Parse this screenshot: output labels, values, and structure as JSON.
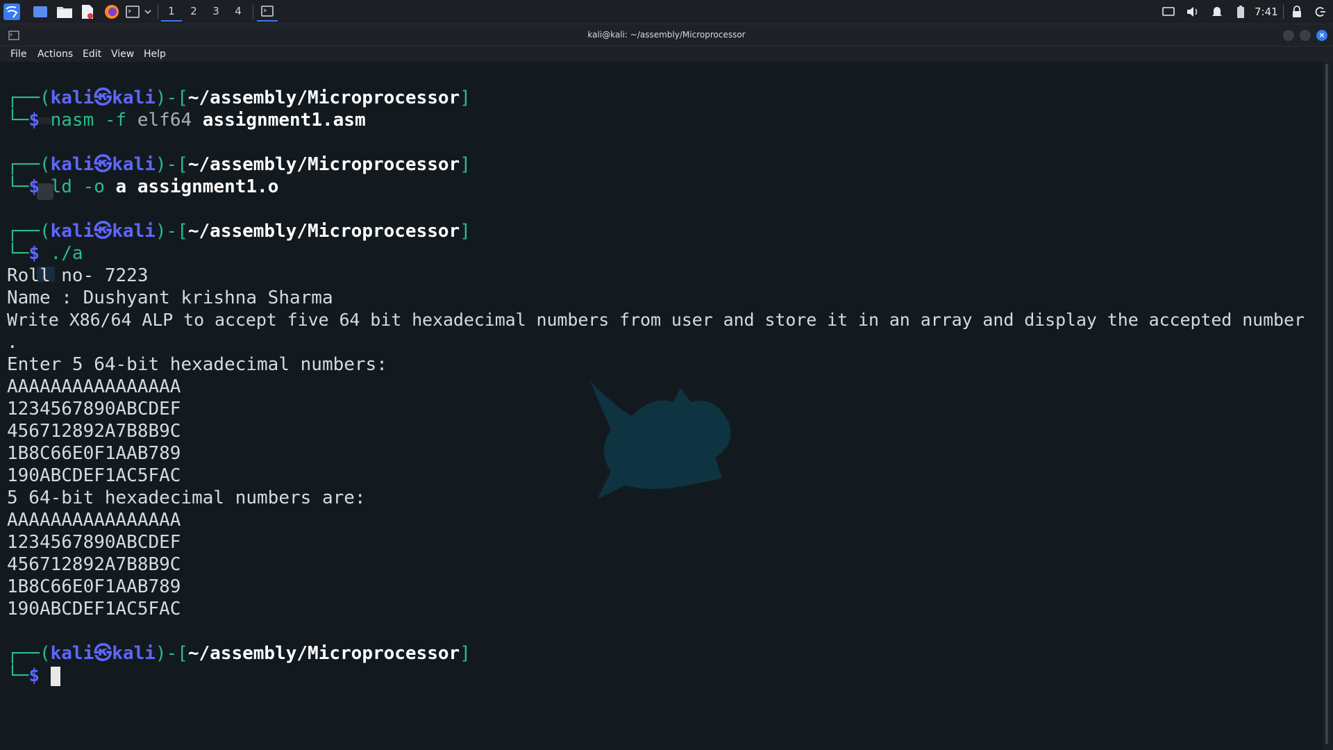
{
  "panel": {
    "workspaces": [
      "1",
      "2",
      "3",
      "4"
    ],
    "active_workspace": "1",
    "clock": "7:41"
  },
  "window": {
    "title": "kali@kali: ~/assembly/Microprocessor"
  },
  "menu": {
    "items": [
      "File",
      "Actions",
      "Edit",
      "View",
      "Help"
    ]
  },
  "terminal": {
    "prompt": {
      "open": "┌──(",
      "user": "kali",
      "at": "㉿",
      "host": "kali",
      "mid": ")-[",
      "cwd": "~/assembly/Microprocessor",
      "close": "]",
      "second_prefix": "└─",
      "dollar": "$"
    },
    "commands": {
      "c1": {
        "bin": "nasm",
        "flag": " -f",
        "arg": " elf64",
        "file": " assignment1.asm"
      },
      "c2": {
        "bin": "ld",
        "flag": " -o",
        "arg": " a",
        "file": " assignment1.o"
      },
      "c3": {
        "bin": "./a"
      }
    },
    "output": [
      "Roll no- 7223",
      "Name : Dushyant krishna Sharma",
      "Write X86/64 ALP to accept five 64 bit hexadecimal numbers from user and store it in an array and display the accepted number",
      ".",
      "Enter 5 64-bit hexadecimal numbers:",
      "AAAAAAAAAAAAAAAA",
      "1234567890ABCDEF",
      "456712892A7B8B9C",
      "1B8C66E0F1AAB789",
      "190ABCDEF1AC5FAC",
      "5 64-bit hexadecimal numbers are:",
      "AAAAAAAAAAAAAAAA",
      "1234567890ABCDEF",
      "456712892A7B8B9C",
      "1B8C66E0F1AAB789",
      "190ABCDEF1AC5FAC"
    ]
  },
  "colors": {
    "accent": "#367bf0",
    "prompt_green": "#2bbc8a",
    "prompt_blue": "#5e67ff"
  }
}
